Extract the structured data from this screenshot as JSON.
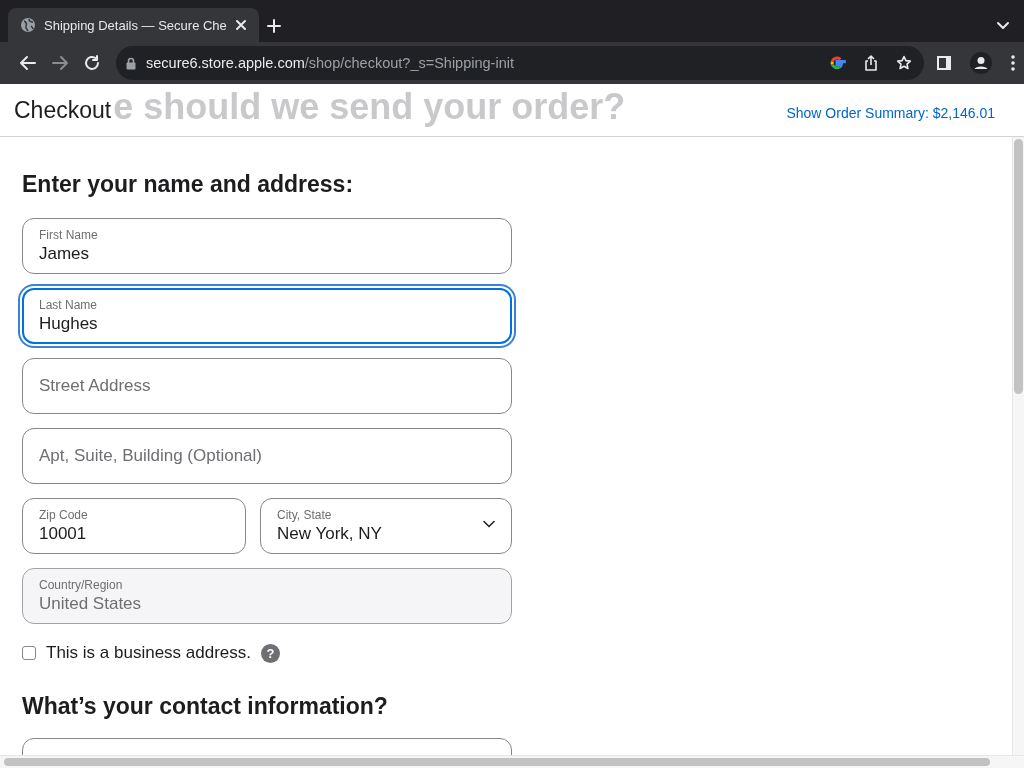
{
  "browser": {
    "tabs": [
      {
        "title": "Shipping Details — Secure Che",
        "selected": true
      }
    ],
    "address": {
      "host": "secure6.store.apple.com",
      "path": "/shop/checkout?_s=Shipping-init",
      "secure": true
    }
  },
  "header": {
    "title": "Checkout",
    "ghost_heading": "e should we send your order?",
    "summary_link": "Show Order Summary: $2,146.01"
  },
  "address_section": {
    "heading": "Enter your name and address:",
    "rows": [
      {
        "fields": [
          {
            "kind": "text",
            "label": "First Name",
            "value": "James",
            "focused": false,
            "disabled": false
          }
        ]
      },
      {
        "fields": [
          {
            "kind": "text",
            "label": "Last Name",
            "value": "Hughes",
            "focused": true,
            "disabled": false
          }
        ]
      },
      {
        "fields": [
          {
            "kind": "text",
            "placeholder": "Street Address",
            "focused": false,
            "disabled": false
          }
        ]
      },
      {
        "fields": [
          {
            "kind": "text",
            "placeholder": "Apt, Suite, Building (Optional)",
            "focused": false,
            "disabled": false
          }
        ]
      },
      {
        "fields": [
          {
            "kind": "text",
            "label": "Zip Code",
            "value": "10001",
            "focused": false,
            "disabled": false
          },
          {
            "kind": "select",
            "label": "City, State",
            "value": "New York, NY",
            "focused": false,
            "disabled": false
          }
        ]
      },
      {
        "fields": [
          {
            "kind": "text",
            "label": "Country/Region",
            "value": "United States",
            "focused": false,
            "disabled": true
          }
        ]
      }
    ],
    "business_checkbox": {
      "label": "This is a business address.",
      "checked": false,
      "help": "?"
    }
  },
  "contact_section": {
    "heading": "What’s your contact information?",
    "rows": [
      {
        "fields": [
          {
            "kind": "text",
            "focused": false,
            "disabled": false
          }
        ]
      }
    ]
  }
}
